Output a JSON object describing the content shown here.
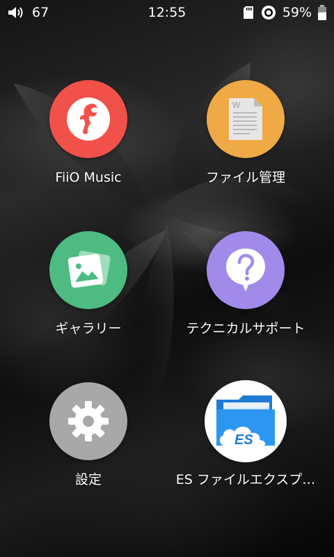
{
  "status_bar": {
    "volume_icon": "speaker-volume-icon",
    "volume": "67",
    "time": "12:55",
    "sd_card_icon": "sd-card-icon",
    "usb_icon": "circle-badge-icon",
    "battery": "59%",
    "battery_icon": "battery-icon",
    "battery_level": 0.59
  },
  "apps": [
    {
      "label": "FiiO Music",
      "icon": "fiio-music-icon",
      "color": "#F2514A"
    },
    {
      "label": "ファイル管理",
      "icon": "file-document-icon",
      "color": "#EFAA45"
    },
    {
      "label": "ギャラリー",
      "icon": "gallery-image-icon",
      "color": "#4DBB82"
    },
    {
      "label": "テクニカルサポート",
      "icon": "help-question-icon",
      "color": "#A08BEA"
    },
    {
      "label": "設定",
      "icon": "settings-gear-icon",
      "color": "#A8A8A8"
    },
    {
      "label": "ES ファイルエクスプ…",
      "icon": "es-file-explorer-icon",
      "color": "#FFFFFF"
    }
  ]
}
